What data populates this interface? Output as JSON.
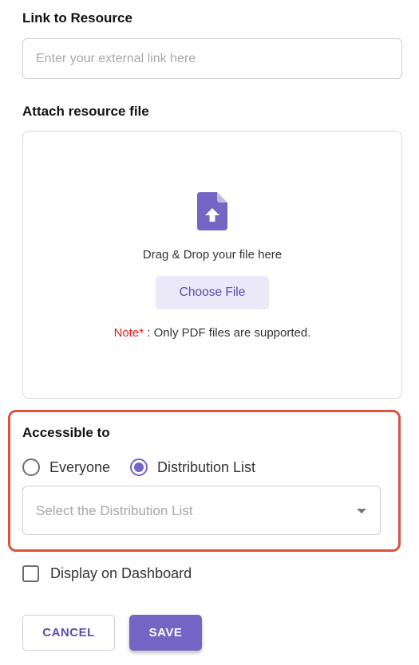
{
  "link": {
    "label": "Link to Resource",
    "placeholder": "Enter your external link here",
    "value": ""
  },
  "attach": {
    "label": "Attach resource file",
    "icon": "file-upload-icon",
    "drop_text": "Drag & Drop your file here",
    "choose_label": "Choose File",
    "note_prefix": "Note*",
    "note_text": " : Only PDF files are supported."
  },
  "access": {
    "label": "Accessible to",
    "options": [
      {
        "label": "Everyone",
        "selected": false
      },
      {
        "label": "Distribution List",
        "selected": true
      }
    ],
    "select_placeholder": "Select the Distribution List",
    "select_icon": "chevron-down-icon"
  },
  "dashboard": {
    "label": "Display on Dashboard",
    "checked": false
  },
  "actions": {
    "cancel_label": "CANCEL",
    "save_label": "SAVE"
  },
  "colors": {
    "accent": "#7464c3",
    "accent_light": "#ebe8f7",
    "note_red": "#e81a1a",
    "highlight_border": "#d9533f"
  }
}
